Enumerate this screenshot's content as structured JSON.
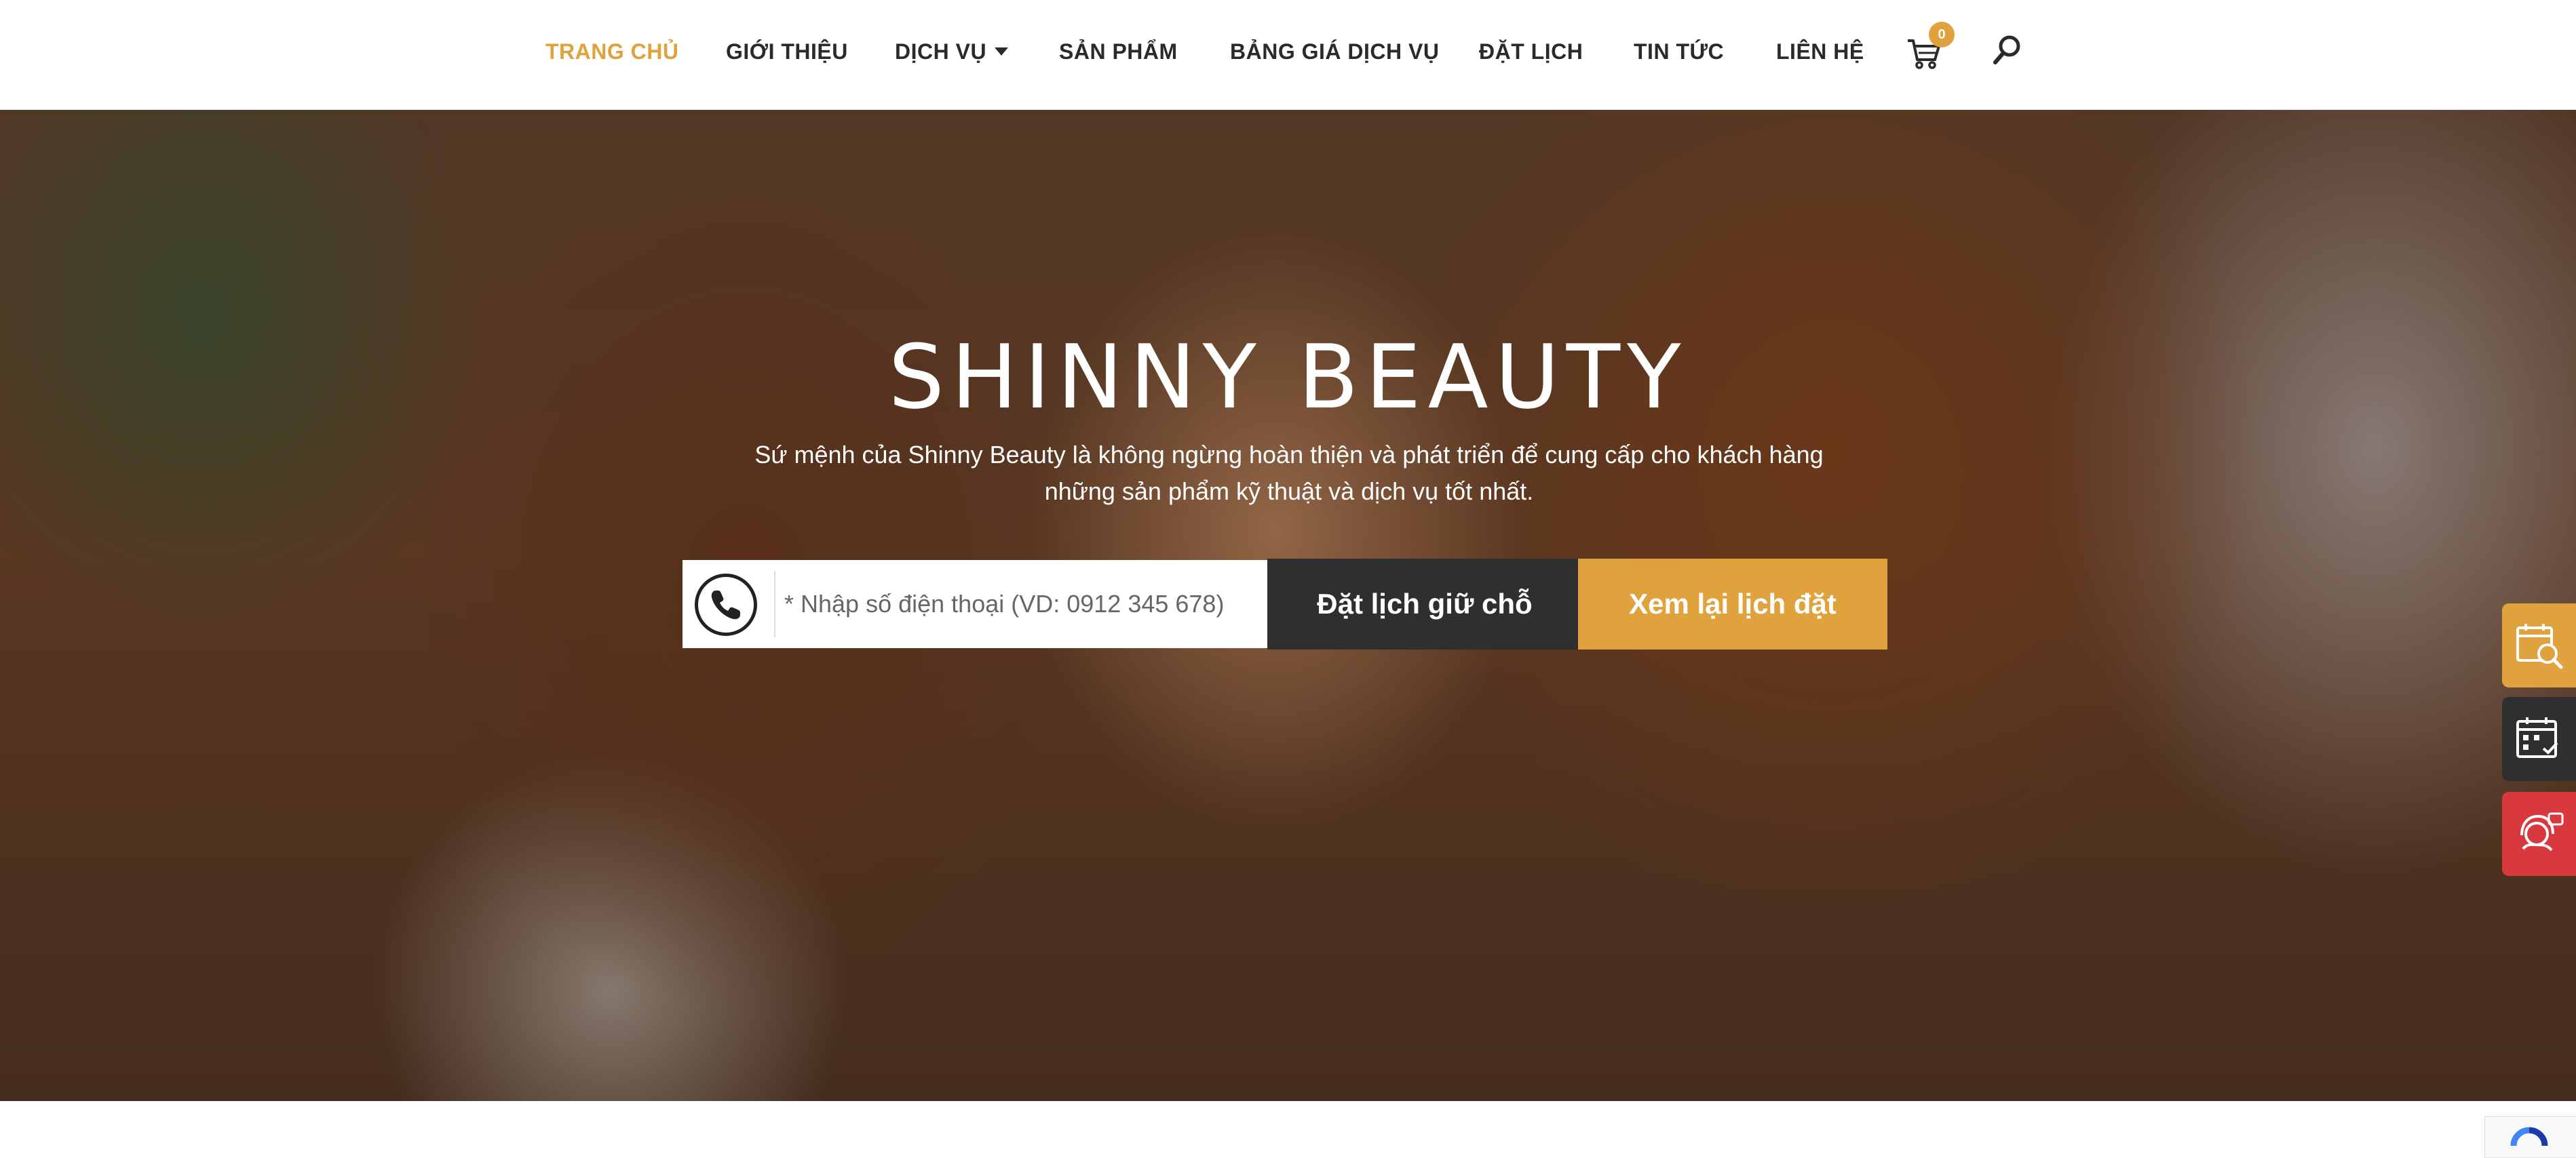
{
  "nav": {
    "items": [
      {
        "label": "TRANG CHỦ",
        "active": true
      },
      {
        "label": "GIỚI THIỆU"
      },
      {
        "label": "DỊCH VỤ",
        "has_dropdown": true
      },
      {
        "label": "SẢN PHẨM"
      },
      {
        "label": "BẢNG GIÁ DỊCH VỤ"
      },
      {
        "label": "ĐẶT LỊCH"
      },
      {
        "label": "TIN TỨC"
      },
      {
        "label": "LIÊN HỆ"
      }
    ],
    "cart_count": "0",
    "cart_icon": "cart-icon",
    "search_icon": "search-icon"
  },
  "hero": {
    "title": "SHINNY BEAUTY",
    "subtitle_line1": "Sứ mệnh của Shinny Beauty là không ngừng hoàn thiện và phát triển để cung cấp cho khách hàng",
    "subtitle_line2": "những sản phẩm kỹ thuật và dịch vụ tốt nhất."
  },
  "booking": {
    "phone_placeholder": "* Nhập số điện thoại (VD: 0912 345 678)",
    "phone_value": "",
    "book_label": "Đặt lịch giữ chỗ",
    "view_label": "Xem lại lịch đặt"
  },
  "colors": {
    "accent": "#e0a23c",
    "dark": "#2f2f2f",
    "red": "#d8393f"
  },
  "side_buttons": [
    {
      "icon": "calendar-search-icon"
    },
    {
      "icon": "calendar-check-icon"
    },
    {
      "icon": "consultant-icon"
    }
  ]
}
